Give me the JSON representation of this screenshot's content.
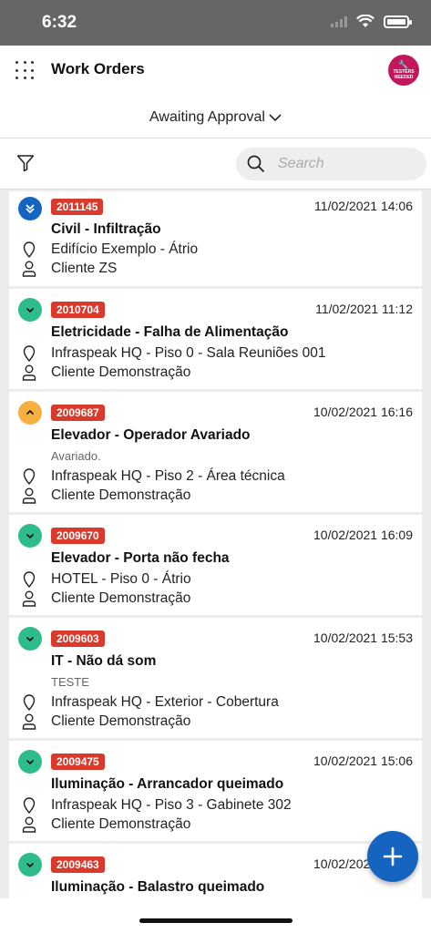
{
  "status": {
    "time": "6:32"
  },
  "header": {
    "title": "Work Orders",
    "badge_line1": "TESTERS",
    "badge_line2": "NEEDED"
  },
  "filter": {
    "label": "Awaiting Approval"
  },
  "search": {
    "placeholder": "Search"
  },
  "colors": {
    "code_badge": "#d93a2b",
    "priority_high": "#1565c0",
    "priority_normal": "#2ebd8a",
    "priority_medium": "#f5b041",
    "fab": "#1565c0"
  },
  "orders": [
    {
      "code": "2011145",
      "date": "11/02/2021 14:06",
      "title": "Civil - Infiltração",
      "description": "",
      "location": "Edifício Exemplo - Átrio",
      "client": "Cliente ZS",
      "priority_icon": "double-chevron-down-icon"
    },
    {
      "code": "2010704",
      "date": "11/02/2021 11:12",
      "title": "Eletricidade - Falha de Alimentação",
      "description": "",
      "location": "Infraspeak HQ - Piso 0 - Sala Reuniões 001",
      "client": "Cliente Demonstração",
      "priority_icon": "chevron-down-icon"
    },
    {
      "code": "2009687",
      "date": "10/02/2021 16:16",
      "title": "Elevador - Operador Avariado",
      "description": "Avariado.",
      "location": "Infraspeak HQ - Piso 2 - Área técnica",
      "client": "Cliente Demonstração",
      "priority_icon": "chevron-up-icon"
    },
    {
      "code": "2009670",
      "date": "10/02/2021 16:09",
      "title": "Elevador - Porta não fecha",
      "description": "",
      "location": "HOTEL - Piso 0 - Átrio",
      "client": "Cliente Demonstração",
      "priority_icon": "chevron-down-icon"
    },
    {
      "code": "2009603",
      "date": "10/02/2021 15:53",
      "title": "IT - Não dá som",
      "description": "TESTE",
      "location": "Infraspeak HQ - Exterior - Cobertura",
      "client": "Cliente Demonstração",
      "priority_icon": "chevron-down-icon"
    },
    {
      "code": "2009475",
      "date": "10/02/2021 15:06",
      "title": "Iluminação - Arrancador queimado",
      "description": "",
      "location": "Infraspeak HQ - Piso 3 - Gabinete 302",
      "client": "Cliente Demonstração",
      "priority_icon": "chevron-down-icon"
    },
    {
      "code": "2009463",
      "date": "10/02/2021 15:05",
      "title": "Iluminação - Balastro queimado",
      "description": "",
      "location": "",
      "client": "",
      "priority_icon": "chevron-down-icon"
    }
  ]
}
